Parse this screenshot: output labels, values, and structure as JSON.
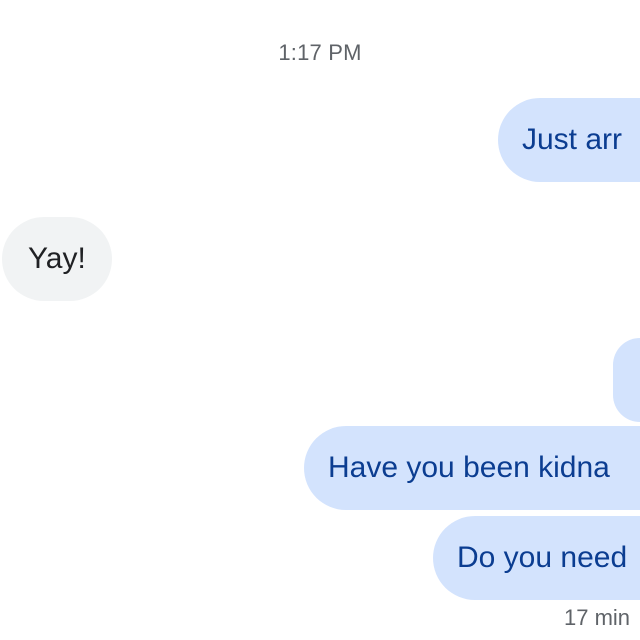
{
  "thread": {
    "timestamp": "1:17 PM",
    "messages": [
      {
        "direction": "outgoing",
        "text": "Just arr"
      },
      {
        "direction": "incoming",
        "text": "Yay!"
      },
      {
        "direction": "outgoing",
        "text": ""
      },
      {
        "direction": "outgoing",
        "text": "Have you been kidna"
      },
      {
        "direction": "outgoing",
        "text": "Do you need"
      }
    ],
    "status": "17 min"
  },
  "colors": {
    "outgoing_bubble": "#d3e3fd",
    "outgoing_text": "#0b3d91",
    "incoming_bubble": "#f1f3f4",
    "incoming_text": "#202124",
    "meta_text": "#5f6368"
  }
}
